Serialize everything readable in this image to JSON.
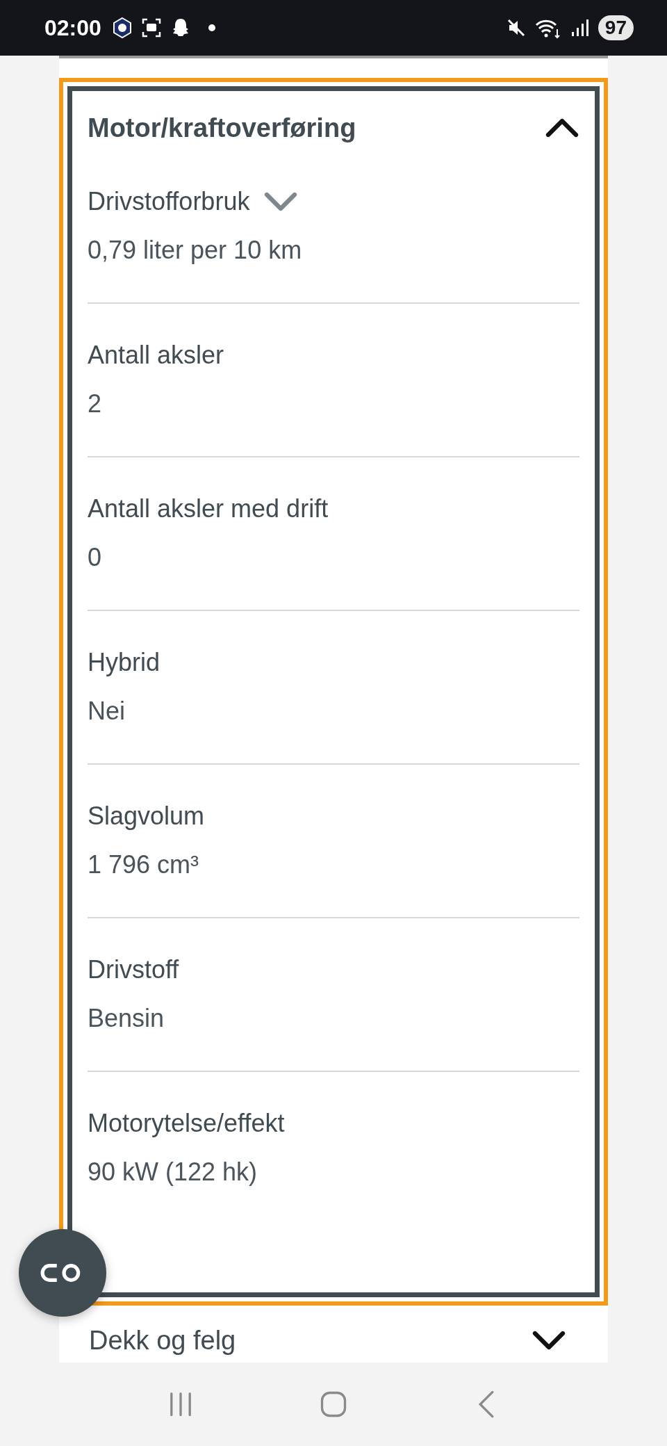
{
  "status_bar": {
    "time": "02:00",
    "battery": "97"
  },
  "section": {
    "title": "Motor/kraftoverføring",
    "expanded": true,
    "items": [
      {
        "label": "Drivstofforbruk",
        "value": "0,79 liter per 10 km",
        "expandable": true
      },
      {
        "label": "Antall aksler",
        "value": "2",
        "expandable": false
      },
      {
        "label": "Antall aksler med drift",
        "value": "0",
        "expandable": false
      },
      {
        "label": "Hybrid",
        "value": "Nei",
        "expandable": false
      },
      {
        "label": "Slagvolum",
        "value": "1 796 cm³",
        "expandable": false
      },
      {
        "label": "Drivstoff",
        "value": "Bensin",
        "expandable": false
      },
      {
        "label": "Motorytelse/effekt",
        "value": "90 kW (122 hk)",
        "expandable": false
      }
    ]
  },
  "next_section": {
    "title": "Dekk og felg",
    "expanded": false
  }
}
